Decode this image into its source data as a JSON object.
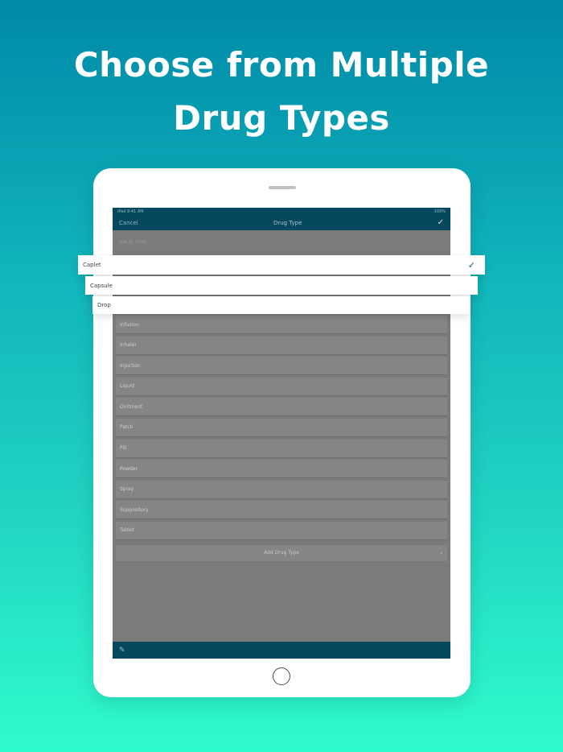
{
  "headline": {
    "line1": "Choose from Multiple",
    "line2": "Drug Types"
  },
  "status_bar": {
    "left": "iPad  9:41 AM",
    "right": "100%"
  },
  "nav": {
    "cancel": "Cancel",
    "title": "Drug Type",
    "confirm_icon": "checkmark-icon"
  },
  "section_header": "DRUG TYPE",
  "popouts": [
    {
      "label": "Caplet",
      "selected": true
    },
    {
      "label": "Capsule",
      "selected": false
    },
    {
      "label": "Drop",
      "selected": false
    }
  ],
  "list_items": [
    "Infusion",
    "Inhaler",
    "Injection",
    "Liquid",
    "Ointment",
    "Patch",
    "Pill",
    "Powder",
    "Spray",
    "Suppository",
    "Tablet"
  ],
  "add_row": {
    "label": "Add Drug Type",
    "icon": "chevron-right-icon"
  },
  "bottom_bar": {
    "icon": "pencil-icon"
  },
  "colors": {
    "nav": "#06485d",
    "accent": "#0a5a73"
  }
}
